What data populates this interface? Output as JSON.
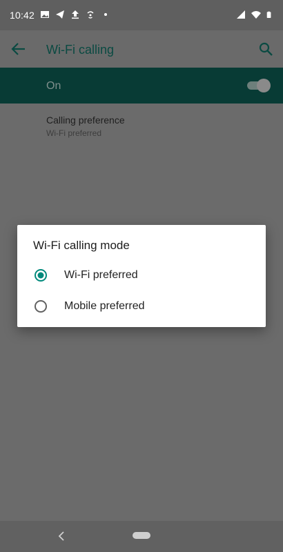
{
  "status_bar": {
    "time": "10:42",
    "left_icons": [
      "image-icon",
      "telegram-icon",
      "upload-icon",
      "hotspot-icon",
      "dot-icon"
    ],
    "right_icons": [
      "signal-icon",
      "wifi-icon",
      "battery-icon"
    ]
  },
  "app_bar": {
    "title": "Wi-Fi calling"
  },
  "main_switch": {
    "label": "On",
    "checked": true
  },
  "preference": {
    "title": "Calling preference",
    "summary": "Wi-Fi preferred"
  },
  "dialog": {
    "title": "Wi-Fi calling mode",
    "options": [
      {
        "label": "Wi-Fi preferred",
        "selected": true
      },
      {
        "label": "Mobile preferred",
        "selected": false
      }
    ]
  },
  "colors": {
    "accent": "#00897b",
    "scrim": "#6b6b6b"
  }
}
